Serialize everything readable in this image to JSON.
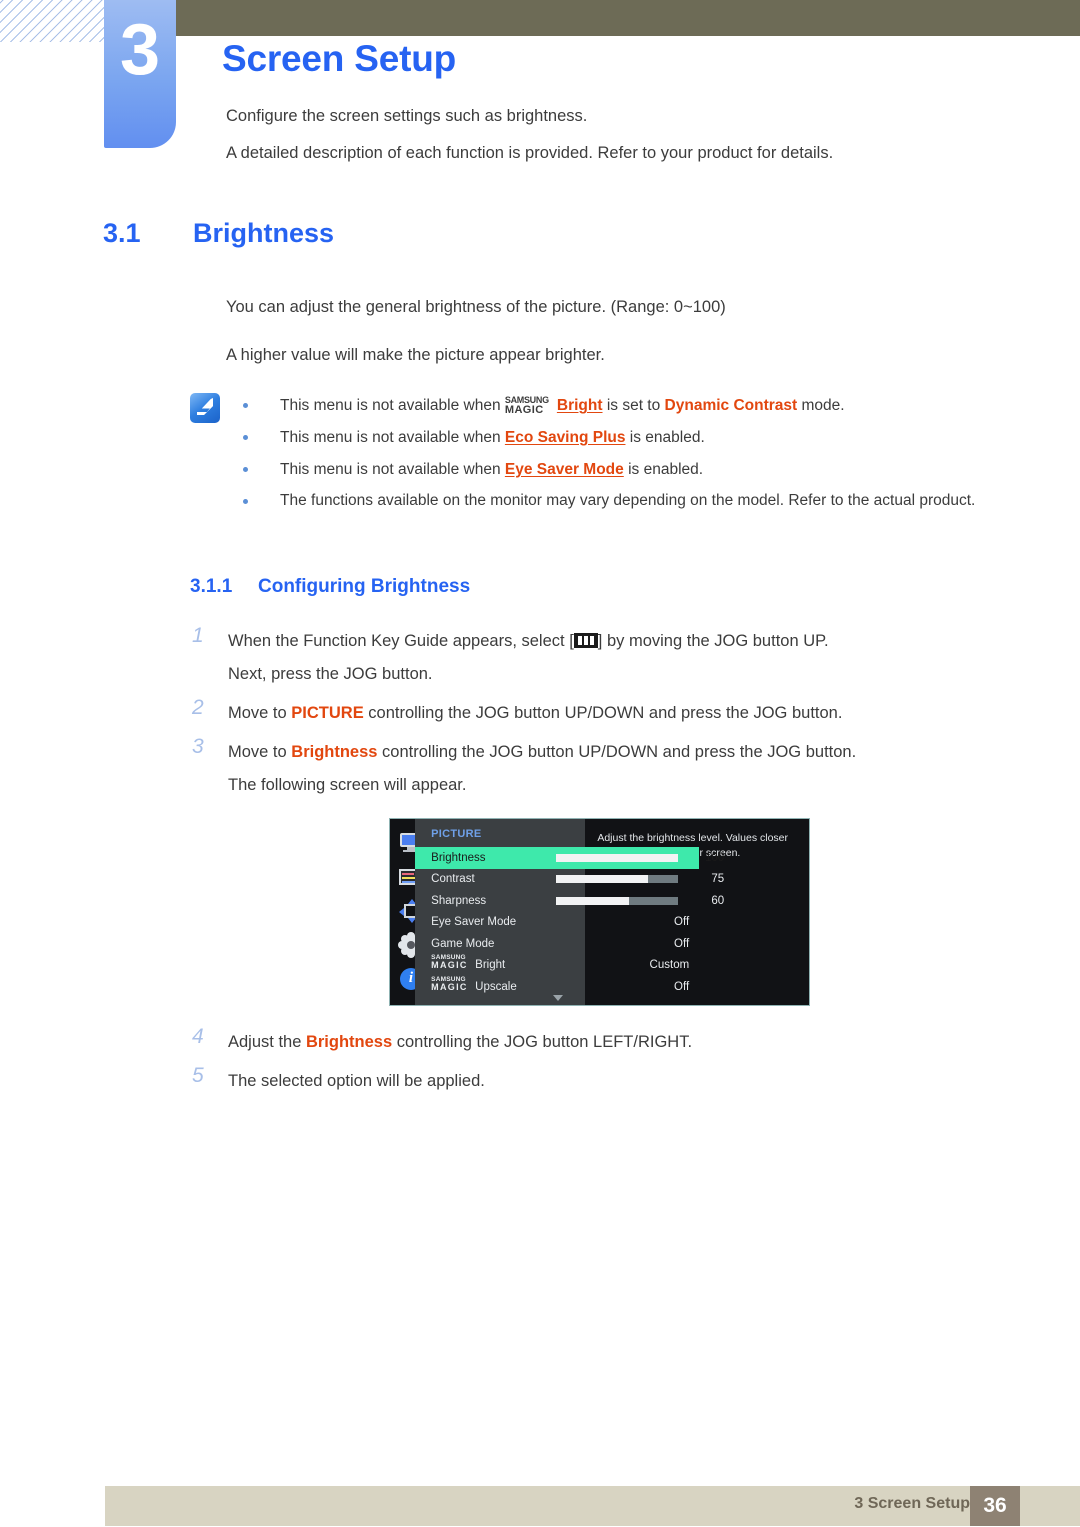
{
  "header": {
    "chapter_number": "3",
    "chapter_title": "Screen Setup",
    "intro_line_1": "Configure the screen settings such as brightness.",
    "intro_line_2": "A detailed description of each function is provided. Refer to your product for details.",
    "accent_color": "#2663f2",
    "tab_color": "#7aa5f0",
    "bar_color": "#6d6b56"
  },
  "section": {
    "number": "3.1",
    "title": "Brightness",
    "paragraph_1": "You can adjust the general brightness of the picture. (Range: 0~100)",
    "paragraph_2": "A higher value will make the picture appear brighter."
  },
  "note": {
    "icon": "note-pen-icon",
    "bullets": [
      {
        "pre": "This menu is not available when ",
        "magic_top": "SAMSUNG",
        "magic_bottom": "MAGIC",
        "magic_suffix": "Bright",
        "mid": " is set to ",
        "highlight": "Dynamic Contrast",
        "post": " mode."
      },
      {
        "pre": "This menu is not available when ",
        "highlight": "Eco Saving Plus",
        "post": " is enabled."
      },
      {
        "pre": "This menu is not available when ",
        "highlight": "Eye Saver Mode",
        "post": " is enabled."
      },
      {
        "plain": "The functions available on the monitor may vary depending on the model. Refer to the actual product."
      }
    ],
    "highlight_color": "#e2470f"
  },
  "subsection": {
    "number": "3.1.1",
    "title": "Configuring Brightness"
  },
  "steps": [
    {
      "number": "1",
      "line_1_pre": "When the Function Key Guide appears, select [",
      "line_1_icon": "menu-bars-icon",
      "line_1_post": "] by moving the JOG button UP.",
      "line_2": "Next, press the JOG button."
    },
    {
      "number": "2",
      "pre": "Move to ",
      "highlight": "PICTURE",
      "post": " controlling the JOG button UP/DOWN and press the JOG button."
    },
    {
      "number": "3",
      "pre": "Move to ",
      "highlight": "Brightness",
      "post": " controlling the JOG button UP/DOWN and press the JOG button.",
      "line_2": "The following screen will appear."
    },
    {
      "number": "4",
      "pre": "Adjust the ",
      "highlight": "Brightness",
      "post": " controlling the JOG button LEFT/RIGHT."
    },
    {
      "number": "5",
      "plain": "The selected option will be applied."
    }
  ],
  "osd": {
    "title": "PICTURE",
    "title_color": "#6fa0e8",
    "selected_color": "#3ee9ab",
    "rail_icons": [
      "monitor-icon",
      "osd-display-icon",
      "pip-move-icon",
      "gear-settings-icon",
      "information-icon"
    ],
    "rows": [
      {
        "label": "Brightness",
        "type": "slider",
        "value": "100",
        "percent": 100,
        "selected": true
      },
      {
        "label": "Contrast",
        "type": "slider",
        "value": "75",
        "percent": 75,
        "selected": false
      },
      {
        "label": "Sharpness",
        "type": "slider",
        "value": "60",
        "percent": 60,
        "selected": false
      },
      {
        "label": "Eye Saver Mode",
        "type": "value",
        "value": "Off",
        "selected": false
      },
      {
        "label": "Game Mode",
        "type": "value",
        "value": "Off",
        "selected": false
      },
      {
        "label": "Bright",
        "type": "magic",
        "value": "Custom",
        "magic_top": "SAMSUNG",
        "magic_bottom": "MAGIC",
        "selected": false
      },
      {
        "label": "Upscale",
        "type": "magic",
        "value": "Off",
        "magic_top": "SAMSUNG",
        "magic_bottom": "MAGIC",
        "selected": false
      }
    ],
    "scroll_indicator": "chevron-down-icon",
    "help_text": "Adjust the brightness level. Values closer to 100 mean a brighter screen."
  },
  "footer": {
    "text": "3 Screen Setup",
    "page_number": "36",
    "bar_color": "#d8d4c2",
    "page_box_color": "#8e8273"
  }
}
